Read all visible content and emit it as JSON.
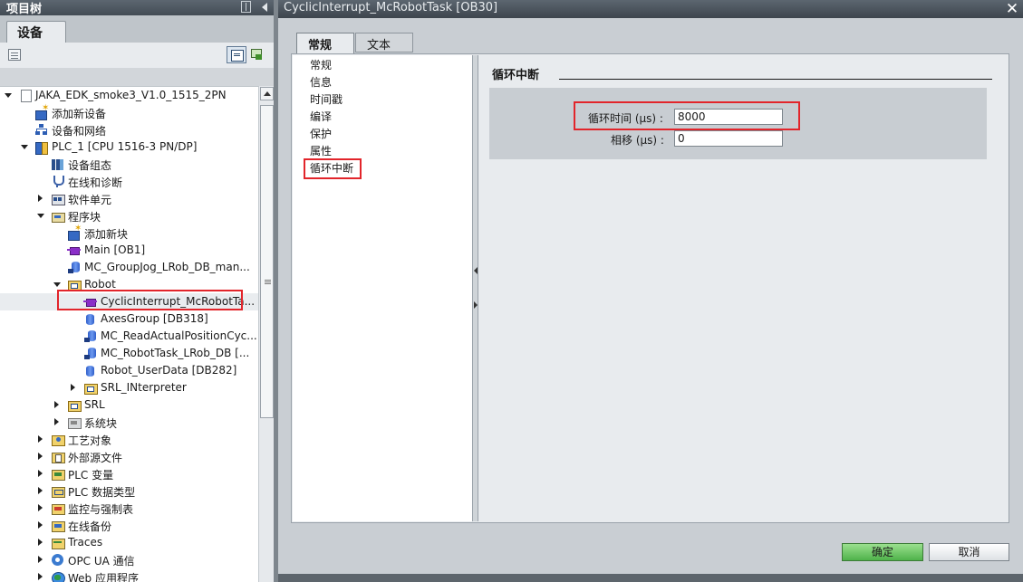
{
  "project_tree": {
    "title": "项目树",
    "tab": "设备",
    "items": [
      {
        "label": "JAKA_EDK_smoke3_V1.0_1515_2PN",
        "icon": "project-icon",
        "arrow": "expanded",
        "level": 0
      },
      {
        "label": "添加新设备",
        "icon": "add-device-icon",
        "arrow": "none",
        "level": 1
      },
      {
        "label": "设备和网络",
        "icon": "network-icon",
        "arrow": "none",
        "level": 1
      },
      {
        "label": "PLC_1 [CPU 1516-3 PN/DP]",
        "icon": "plc-icon",
        "arrow": "expanded",
        "level": 1
      },
      {
        "label": "设备组态",
        "icon": "device-config-icon",
        "arrow": "none",
        "level": 2
      },
      {
        "label": "在线和诊断",
        "icon": "diagnostics-icon",
        "arrow": "none",
        "level": 2
      },
      {
        "label": "软件单元",
        "icon": "software-units-icon",
        "arrow": "collapsed",
        "level": 2
      },
      {
        "label": "程序块",
        "icon": "program-blocks-icon",
        "arrow": "expanded",
        "level": 2
      },
      {
        "label": "添加新块",
        "icon": "add-block-icon",
        "arrow": "none",
        "level": 3
      },
      {
        "label": "Main [OB1]",
        "icon": "ob-icon",
        "arrow": "none",
        "level": 3
      },
      {
        "label": "MC_GroupJog_LRob_DB_man...",
        "icon": "instance-db-icon",
        "arrow": "none",
        "level": 3
      },
      {
        "label": "Robot",
        "icon": "folder-icon",
        "arrow": "expanded",
        "level": 3
      },
      {
        "label": "CyclicInterrupt_McRobotTa...",
        "icon": "ob-icon",
        "arrow": "none",
        "level": 4,
        "selected": true
      },
      {
        "label": "AxesGroup [DB318]",
        "icon": "db-icon",
        "arrow": "none",
        "level": 4
      },
      {
        "label": "MC_ReadActualPositionCyc...",
        "icon": "instance-db-icon",
        "arrow": "none",
        "level": 4
      },
      {
        "label": "MC_RobotTask_LRob_DB [...",
        "icon": "instance-db-icon",
        "arrow": "none",
        "level": 4
      },
      {
        "label": "Robot_UserData [DB282]",
        "icon": "db-icon",
        "arrow": "none",
        "level": 4
      },
      {
        "label": "SRL_INterpreter",
        "icon": "folder-icon",
        "arrow": "collapsed",
        "level": 4
      },
      {
        "label": "SRL",
        "icon": "folder-icon",
        "arrow": "collapsed",
        "level": 3
      },
      {
        "label": "系统块",
        "icon": "system-blocks-icon",
        "arrow": "collapsed",
        "level": 3
      },
      {
        "label": "工艺对象",
        "icon": "technology-objects-icon",
        "arrow": "collapsed",
        "level": 2
      },
      {
        "label": "外部源文件",
        "icon": "external-sources-icon",
        "arrow": "collapsed",
        "level": 2
      },
      {
        "label": "PLC 变量",
        "icon": "plc-tags-icon",
        "arrow": "collapsed",
        "level": 2
      },
      {
        "label": "PLC 数据类型",
        "icon": "plc-data-types-icon",
        "arrow": "collapsed",
        "level": 2
      },
      {
        "label": "监控与强制表",
        "icon": "watch-tables-icon",
        "arrow": "collapsed",
        "level": 2
      },
      {
        "label": "在线备份",
        "icon": "online-backups-icon",
        "arrow": "collapsed",
        "level": 2
      },
      {
        "label": "Traces",
        "icon": "traces-icon",
        "arrow": "collapsed",
        "level": 2
      },
      {
        "label": "OPC UA 通信",
        "icon": "opc-ua-icon",
        "arrow": "collapsed",
        "level": 2
      },
      {
        "label": "Web 应用程序",
        "icon": "web-app-icon",
        "arrow": "collapsed",
        "level": 2
      }
    ]
  },
  "dialog": {
    "title": "CyclicInterrupt_McRobotTask [OB30]",
    "tabs": [
      "常规",
      "文本"
    ],
    "nav": [
      "常规",
      "信息",
      "时间戳",
      "编译",
      "保护",
      "属性",
      "循环中断"
    ],
    "section_title": "循环中断",
    "fields": {
      "cycle_time_label": "循环时间 (µs) :",
      "cycle_time_value": "8000",
      "phase_shift_label": "相移 (µs) :",
      "phase_shift_value": "0"
    },
    "ok_label": "确定",
    "cancel_label": "取消",
    "close_icon": "✕"
  },
  "colors": {
    "title_bar": "#4a535c",
    "highlight_box": "#e2252b",
    "ok_button": "#6cc664"
  }
}
